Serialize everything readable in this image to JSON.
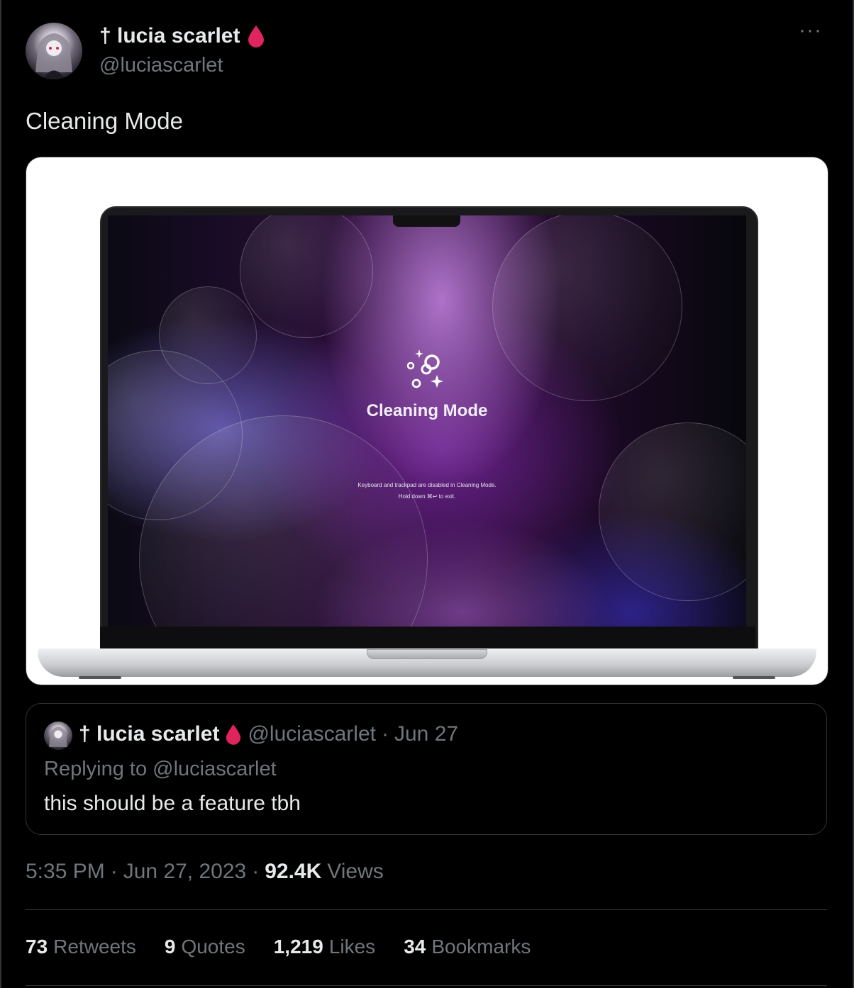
{
  "author": {
    "display_name": "† lucia scarlet",
    "handle": "@luciascarlet",
    "badge_icon": "blood-drop-icon",
    "badge_color": "#e0245e"
  },
  "tweet": {
    "text": "Cleaning Mode",
    "media": {
      "screen_title": "Cleaning Mode",
      "screen_line1": "Keyboard and trackpad are disabled in Cleaning Mode.",
      "screen_line2": "Hold down ⌘↩ to exit."
    }
  },
  "quote": {
    "display_name": "† lucia scarlet",
    "handle": "@luciascarlet",
    "separator": "·",
    "date": "Jun 27",
    "replying_label": "Replying to",
    "replying_handle": "@luciascarlet",
    "text": "this should be a feature tbh"
  },
  "meta": {
    "time": "5:35 PM",
    "sep1": "·",
    "date": "Jun 27, 2023",
    "sep2": "·",
    "views_count": "92.4K",
    "views_label": "Views"
  },
  "stats": [
    {
      "count": "73",
      "label": "Retweets"
    },
    {
      "count": "9",
      "label": "Quotes"
    },
    {
      "count": "1,219",
      "label": "Likes"
    },
    {
      "count": "34",
      "label": "Bookmarks"
    }
  ],
  "colors": {
    "background": "#000000",
    "text": "#e7e9ea",
    "muted": "#71767b",
    "border": "#2f3336"
  }
}
